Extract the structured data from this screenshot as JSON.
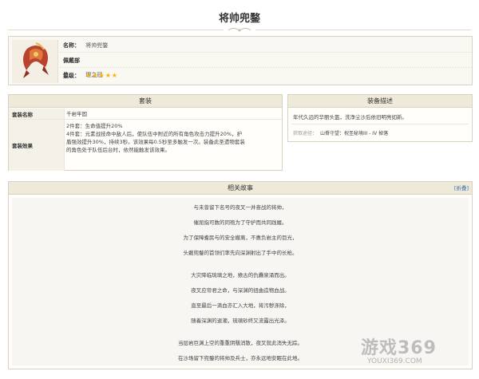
{
  "page_title": "将帅兜鍪",
  "item": {
    "name_label": "名称：",
    "name_value": "将帅兜鍪",
    "slot_label": "佩戴部位：",
    "slot_value": "理之冠",
    "rarity_label": "星级：",
    "rarity_stars": 5,
    "stars_text": "★★★★★",
    "avatar_icon": "helmet-icon"
  },
  "set_panel": {
    "title": "套装",
    "name_key": "套装名称",
    "name_value": "千岩牢固",
    "effect_key": "套装效果",
    "effect_lines": [
      "2件套：生命值提升20%",
      "4件套：元素战技命中敌人后，使队伍中附近的所有角色攻击力提升20%，护",
      "盾强效提升30%，持续3秒。该效果每0.5秒至多触发一次。装备此圣遗物套装",
      "的角色处于队伍后台时，依然能触发该效果。"
    ]
  },
  "desc_panel": {
    "title": "装备描述",
    "description": "年代久远的华丽头盔，洗净尘沙后依旧明亮如新。",
    "source_label": "获取途径：",
    "source_value": "山脊守望：祝圣秘境III - IV 掉落"
  },
  "story_panel": {
    "title": "相关故事",
    "fold_label": "[折叠]",
    "lines": [
      "与未曾留下名号的夜叉一并奋战的将帅，",
      "催屈指可数的同袍为了守护而共同践履。",
      "为了保障耆民与的安全撤离，不惠负岩主的目光，",
      "头戴兜鍪的首领们率先向深渊射出了手中的长枪。",
      "大灾降临琉璃之地，飨古的仇爨泉涌而出。",
      "夜叉应帝君之命，与深渊的扭曲造物血战。",
      "直至最后一滴血亦汇入大地，将污秽涤除，",
      "随着深渊的退潮，琉璃砂终又流露出光泽。",
      "当层岩巨渊上空的重重阴翳消散，夜叉就此消失无踪。",
      "在沙场留下兜鍪的将帅及兵士，亦永远地安眠在此地。"
    ]
  },
  "watermark": {
    "logo": "游戏369",
    "url": "YOUXI369.COM"
  },
  "colors": {
    "panel_header": "#efe9da",
    "border": "#d9d2c2",
    "link": "#3a6fb5",
    "star": "#f5b400"
  }
}
